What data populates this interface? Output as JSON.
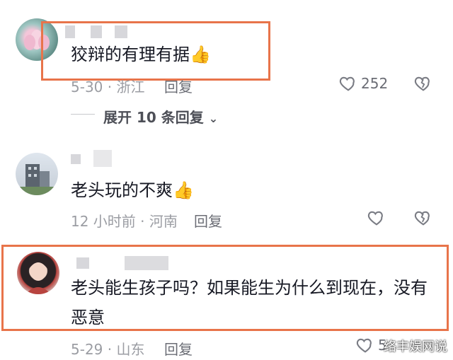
{
  "comments": [
    {
      "text": "狡辩的有理有据",
      "emoji": "👍",
      "meta": "5-30 · 浙江",
      "reply_label": "回复",
      "likes": "252",
      "expand_label": "展开 10 条回复"
    },
    {
      "text": "老头玩的不爽",
      "emoji": "👍",
      "meta": "12 小时前 · 河南",
      "reply_label": "回复"
    },
    {
      "text_line1": "老头能生孩子吗？如果能生为什么到现在，没有",
      "text_line2": "恶意",
      "meta": "5-29 · 山东",
      "reply_label": "回复",
      "likes": "5"
    }
  ],
  "watermark": "络丰娱网说",
  "colors": {
    "highlight": "#e8744a",
    "meta": "#9b9da3"
  }
}
